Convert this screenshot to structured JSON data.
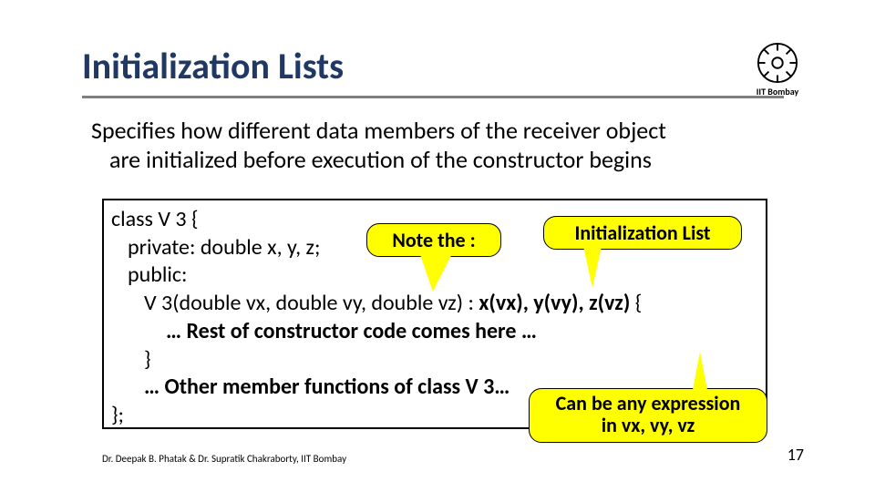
{
  "title": "Initialization Lists",
  "logo_caption": "IIT Bombay",
  "body_line1": "Specifies how different data members of the receiver object",
  "body_line2": "are initialized before execution of the constructor begins",
  "code": {
    "l1": "class V 3 {",
    "l2": "private: double x, y, z;",
    "l3": "public:",
    "l4a": "V 3(double vx, double vy, double vz) : ",
    "l4b": "x(vx), y(vy), z(vz)",
    "l4c": " {",
    "l5": "… Rest of constructor code comes here …",
    "l6": "}",
    "l7": "… Other member functions of class V 3…",
    "l8": "};"
  },
  "callouts": {
    "note": "Note the :",
    "init": "Initialization List",
    "expr_l1": "Can be any expression",
    "expr_l2": "in vx, vy, vz"
  },
  "footer_left": "Dr. Deepak B. Phatak & Dr. Supratik Chakraborty, IIT Bombay",
  "footer_right": "17"
}
